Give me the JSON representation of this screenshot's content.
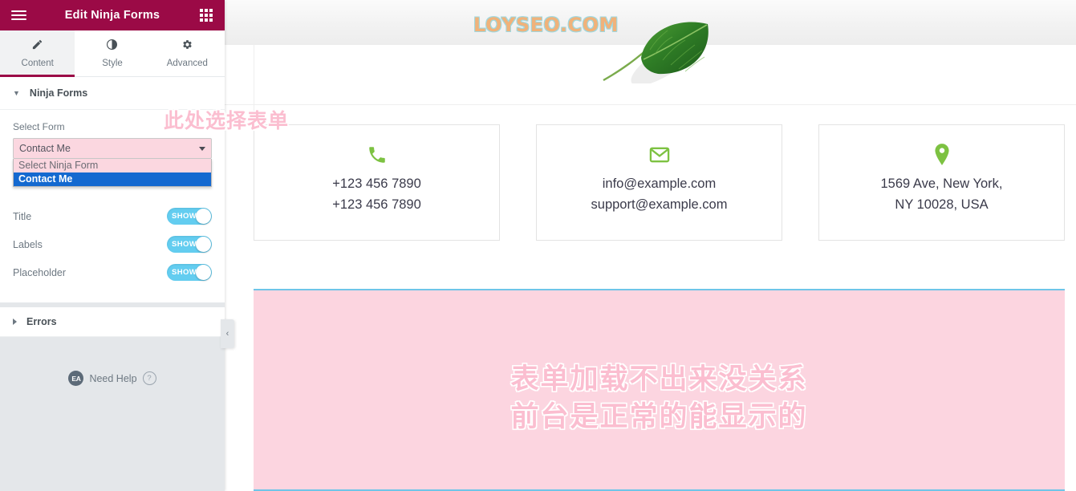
{
  "panel": {
    "header": {
      "title": "Edit Ninja Forms",
      "menu_icon": "hamburger-icon",
      "apps_icon": "grid-apps-icon"
    },
    "tabs": [
      {
        "label": "Content",
        "icon": "pencil-icon",
        "active": true
      },
      {
        "label": "Style",
        "icon": "contrast-icon",
        "active": false
      },
      {
        "label": "Advanced",
        "icon": "gear-icon",
        "active": false
      }
    ],
    "section": {
      "title": "Ninja Forms",
      "expanded": true,
      "caret_icon": "chevron-down-icon"
    },
    "select_form": {
      "label": "Select Form",
      "value": "Contact Me",
      "open": true,
      "caret_icon": "chevron-down-icon",
      "options": [
        {
          "label": "Select Ninja Form",
          "selected": false
        },
        {
          "label": "Contact Me",
          "selected": true
        }
      ]
    },
    "options": [
      {
        "label": "Title",
        "toggle_text": "SHOW",
        "on": true
      },
      {
        "label": "Labels",
        "toggle_text": "SHOW",
        "on": true
      },
      {
        "label": "Placeholder",
        "toggle_text": "SHOW",
        "on": true
      }
    ],
    "errors_section": {
      "title": "Errors",
      "expanded": false,
      "caret_icon": "chevron-right-icon"
    },
    "need_help": {
      "badge": "EA",
      "label": "Need Help",
      "question_icon": "question-mark-icon",
      "question_glyph": "?"
    },
    "collapse_tab": {
      "icon": "chevron-left-icon",
      "glyph": "‹"
    }
  },
  "preview": {
    "watermark": "LOYSEO.COM",
    "leaf_icon": "green-leaf-image",
    "cards": [
      {
        "icon": "phone-icon",
        "lines": [
          "+123 456 7890",
          "+123 456 7890"
        ]
      },
      {
        "icon": "envelope-icon",
        "lines": [
          "info@example.com",
          "support@example.com"
        ]
      },
      {
        "icon": "map-pin-icon",
        "lines": [
          "1569 Ave, New York,",
          "NY 10028, USA"
        ]
      }
    ],
    "form_placeholder": {
      "annotation_line1": "表单加载不出来没关系",
      "annotation_line2": "前台是正常的能显示的"
    }
  },
  "annotations": {
    "select_form_hint": "此处选择表单"
  },
  "colors": {
    "brand": "#9b0a46",
    "accent_green": "#7dc242",
    "toggle_on": "#63cdf0",
    "option_selected": "#1469d0",
    "annotation_pink": "#fbbed0",
    "highlight_pink": "#fbd1de",
    "band_pink": "#fcd5e0",
    "band_border_blue": "#6fc5e8"
  }
}
